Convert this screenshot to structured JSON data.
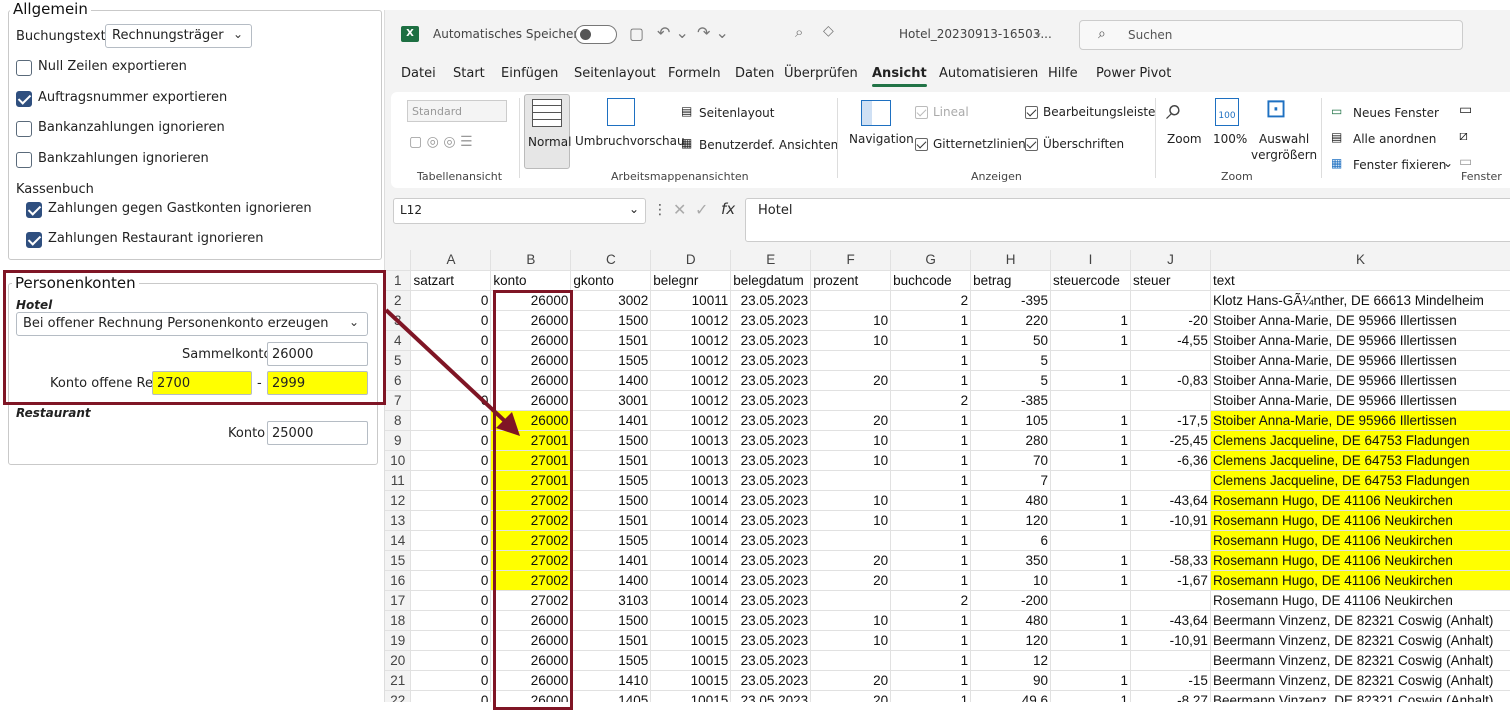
{
  "left": {
    "allgemein_title": "Allgemein",
    "buchungstext_label": "Buchungstext",
    "buchungstext_value": "Rechnungsträger",
    "checks": [
      {
        "label": "Null Zeilen exportieren",
        "checked": false
      },
      {
        "label": "Auftragsnummer exportieren",
        "checked": true
      },
      {
        "label": "Bankanzahlungen ignorieren",
        "checked": false
      },
      {
        "label": "Bankzahlungen ignorieren",
        "checked": false
      }
    ],
    "kassenbuch_label": "Kassenbuch",
    "kassen_checks": [
      {
        "label": "Zahlungen gegen Gastkonten ignorieren",
        "checked": true
      },
      {
        "label": "Zahlungen Restaurant ignorieren",
        "checked": true
      }
    ],
    "personenkonten_title": "Personenkonten",
    "hotel_label": "Hotel",
    "hotel_select": "Bei offener Rechnung Personenkonto erzeugen",
    "sammelkonto_label": "Sammelkonto",
    "sammelkonto_value": "26000",
    "konto_offene_label": "Konto offene Re.",
    "konto_from": "2700",
    "konto_dash": "-",
    "konto_to": "2999",
    "restaurant_label": "Restaurant",
    "konto_label": "Konto",
    "konto_value": "25000"
  },
  "excel": {
    "autosave": "Automatisches Speichern",
    "filename": "Hotel_20230913-16503...",
    "search": "Suchen",
    "menu": [
      "Datei",
      "Start",
      "Einfügen",
      "Seitenlayout",
      "Formeln",
      "Daten",
      "Überprüfen",
      "Ansicht",
      "Automatisieren",
      "Hilfe",
      "Power Pivot"
    ],
    "active_menu": "Ansicht",
    "ribbon": {
      "standard": "Standard",
      "tabellenansicht": "Tabellenansicht",
      "normal": "Normal",
      "umbruch": "Umbruchvorschau",
      "seitenlayout": "Seitenlayout",
      "benutzer": "Benutzerdef. Ansichten",
      "arbeitsmappen": "Arbeitsmappenansichten",
      "navigation": "Navigation",
      "lineal": "Lineal",
      "gitter": "Gitternetzlinien",
      "bearbeitung": "Bearbeitungsleiste",
      "ueberschriften": "Überschriften",
      "anzeigen": "Anzeigen",
      "zoom": "Zoom",
      "hundert": "100%",
      "auswahl1": "Auswahl",
      "auswahl2": "vergrößern",
      "zoom_group": "Zoom",
      "neues_fenster": "Neues Fenster",
      "alle": "Alle anordnen",
      "fixieren": "Fenster fixieren",
      "fenster": "Fenster"
    },
    "namebox": "L12",
    "formula": "Hotel",
    "fx": "fx",
    "columns": [
      "A",
      "B",
      "C",
      "D",
      "E",
      "F",
      "G",
      "H",
      "I",
      "J",
      "K"
    ],
    "headers": [
      "satzart",
      "konto",
      "gkonto",
      "belegnr",
      "belegdatum",
      "prozent",
      "buchcode",
      "betrag",
      "steuercode",
      "steuer",
      "text"
    ],
    "rows": [
      [
        "0",
        "26000",
        "3002",
        "10011",
        "23.05.2023",
        "",
        "2",
        "-395",
        "",
        "",
        "Klotz Hans-GÃ¼nther, DE 66613 Mindelheim"
      ],
      [
        "0",
        "26000",
        "1500",
        "10012",
        "23.05.2023",
        "10",
        "1",
        "220",
        "1",
        "-20",
        "Stoiber Anna-Marie, DE 95966 Illertissen"
      ],
      [
        "0",
        "26000",
        "1501",
        "10012",
        "23.05.2023",
        "10",
        "1",
        "50",
        "1",
        "-4,55",
        "Stoiber Anna-Marie, DE 95966 Illertissen"
      ],
      [
        "0",
        "26000",
        "1505",
        "10012",
        "23.05.2023",
        "",
        "1",
        "5",
        "",
        "",
        "Stoiber Anna-Marie, DE 95966 Illertissen"
      ],
      [
        "0",
        "26000",
        "1400",
        "10012",
        "23.05.2023",
        "20",
        "1",
        "5",
        "1",
        "-0,83",
        "Stoiber Anna-Marie, DE 95966 Illertissen"
      ],
      [
        "0",
        "26000",
        "3001",
        "10012",
        "23.05.2023",
        "",
        "2",
        "-385",
        "",
        "",
        "Stoiber Anna-Marie, DE 95966 Illertissen"
      ],
      [
        "0",
        "26000",
        "1401",
        "10012",
        "23.05.2023",
        "20",
        "1",
        "105",
        "1",
        "-17,5",
        "Stoiber Anna-Marie, DE 95966 Illertissen"
      ],
      [
        "0",
        "27001",
        "1500",
        "10013",
        "23.05.2023",
        "10",
        "1",
        "280",
        "1",
        "-25,45",
        "Clemens Jacqueline, DE 64753 Fladungen"
      ],
      [
        "0",
        "27001",
        "1501",
        "10013",
        "23.05.2023",
        "10",
        "1",
        "70",
        "1",
        "-6,36",
        "Clemens Jacqueline, DE 64753 Fladungen"
      ],
      [
        "0",
        "27001",
        "1505",
        "10013",
        "23.05.2023",
        "",
        "1",
        "7",
        "",
        "",
        "Clemens Jacqueline, DE 64753 Fladungen"
      ],
      [
        "0",
        "27002",
        "1500",
        "10014",
        "23.05.2023",
        "10",
        "1",
        "480",
        "1",
        "-43,64",
        "Rosemann Hugo, DE 41106 Neukirchen"
      ],
      [
        "0",
        "27002",
        "1501",
        "10014",
        "23.05.2023",
        "10",
        "1",
        "120",
        "1",
        "-10,91",
        "Rosemann Hugo, DE 41106 Neukirchen"
      ],
      [
        "0",
        "27002",
        "1505",
        "10014",
        "23.05.2023",
        "",
        "1",
        "6",
        "",
        "",
        "Rosemann Hugo, DE 41106 Neukirchen"
      ],
      [
        "0",
        "27002",
        "1401",
        "10014",
        "23.05.2023",
        "20",
        "1",
        "350",
        "1",
        "-58,33",
        "Rosemann Hugo, DE 41106 Neukirchen"
      ],
      [
        "0",
        "27002",
        "1400",
        "10014",
        "23.05.2023",
        "20",
        "1",
        "10",
        "1",
        "-1,67",
        "Rosemann Hugo, DE 41106 Neukirchen"
      ],
      [
        "0",
        "27002",
        "3103",
        "10014",
        "23.05.2023",
        "",
        "2",
        "-200",
        "",
        "",
        "Rosemann Hugo, DE 41106 Neukirchen"
      ],
      [
        "0",
        "26000",
        "1500",
        "10015",
        "23.05.2023",
        "10",
        "1",
        "480",
        "1",
        "-43,64",
        "Beermann Vinzenz, DE 82321 Coswig (Anhalt)"
      ],
      [
        "0",
        "26000",
        "1501",
        "10015",
        "23.05.2023",
        "10",
        "1",
        "120",
        "1",
        "-10,91",
        "Beermann Vinzenz, DE 82321 Coswig (Anhalt)"
      ],
      [
        "0",
        "26000",
        "1505",
        "10015",
        "23.05.2023",
        "",
        "1",
        "12",
        "",
        "",
        "Beermann Vinzenz, DE 82321 Coswig (Anhalt)"
      ],
      [
        "0",
        "26000",
        "1410",
        "10015",
        "23.05.2023",
        "20",
        "1",
        "90",
        "1",
        "-15",
        "Beermann Vinzenz, DE 82321 Coswig (Anhalt)"
      ],
      [
        "0",
        "26000",
        "1405",
        "10015",
        "23.05.2023",
        "20",
        "1",
        "49,6",
        "1",
        "-8,27",
        "Beermann Vinzenz, DE 82321 Coswig (Anhalt)"
      ]
    ],
    "highlight_rows": [
      8,
      9,
      10,
      11,
      12,
      13,
      14,
      15,
      16
    ]
  },
  "colors": {
    "highlight": "#ffff00",
    "callout": "#7f1525",
    "accent": "#217346"
  }
}
